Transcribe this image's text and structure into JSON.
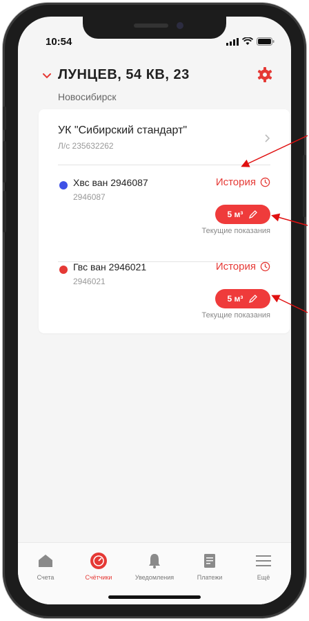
{
  "status": {
    "time": "10:54"
  },
  "header": {
    "address": "ЛУНЦЕВ, 54 КВ, 23",
    "city": "Новосибирск"
  },
  "org": {
    "name": "УК \"Сибирский стандарт\"",
    "account": "Л/с 235632262"
  },
  "meters": [
    {
      "name": "Хвс ван 2946087",
      "number": "2946087",
      "history_label": "История",
      "reading": "5 м³",
      "reading_label": "Текущие показания",
      "dot_color": "#3f51e6"
    },
    {
      "name": "Гвс ван 2946021",
      "number": "2946021",
      "history_label": "История",
      "reading": "5 м³",
      "reading_label": "Текущие показания",
      "dot_color": "#e53935"
    }
  ],
  "tabs": [
    {
      "label": "Счета",
      "icon": "home-icon"
    },
    {
      "label": "Счётчики",
      "icon": "meter-icon",
      "active": true
    },
    {
      "label": "Уведомления",
      "icon": "bell-icon"
    },
    {
      "label": "Платежи",
      "icon": "receipt-icon"
    },
    {
      "label": "Ещё",
      "icon": "menu-icon"
    }
  ],
  "colors": {
    "accent": "#e53935",
    "background": "#f5f5f5",
    "annotation_arrow": "#e01010"
  }
}
